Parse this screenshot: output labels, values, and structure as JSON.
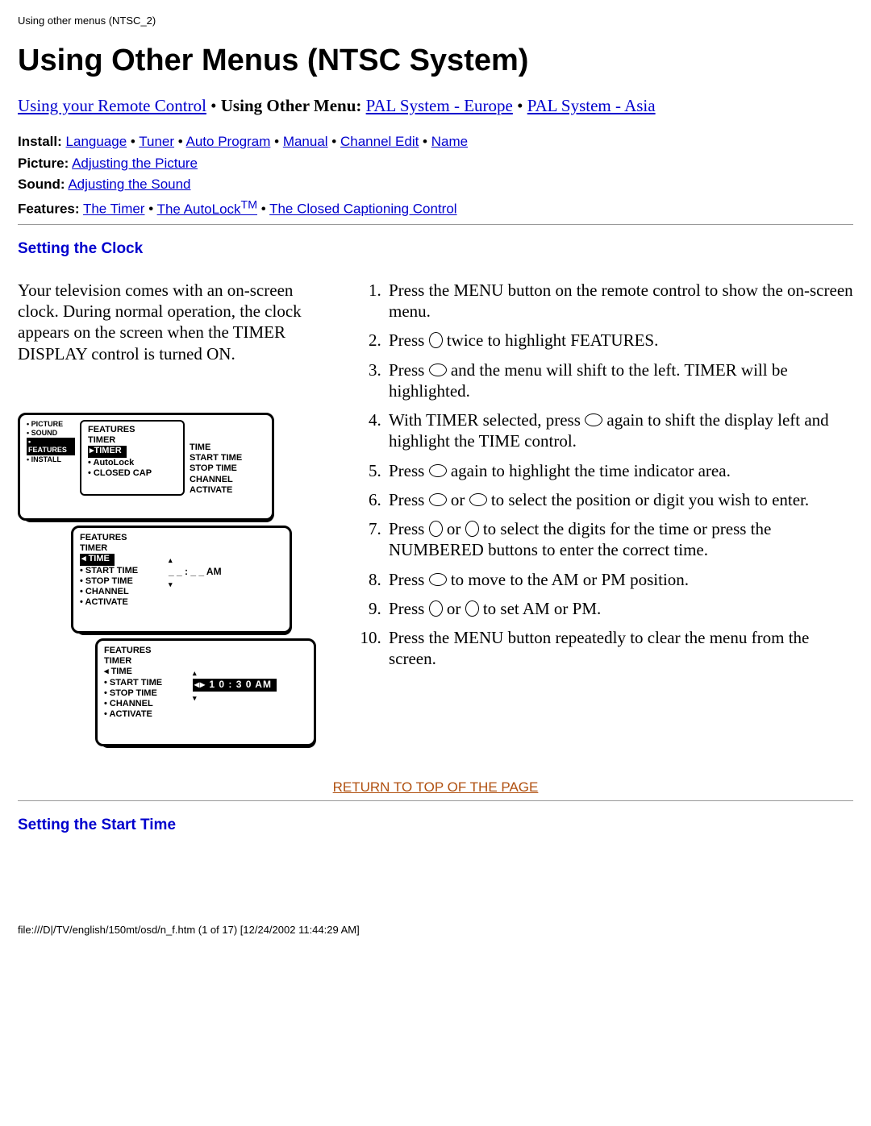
{
  "breadcrumb": "Using other menus (NTSC_2)",
  "page_title": "Using Other Menus (NTSC System)",
  "top_links": {
    "remote": "Using your Remote Control",
    "using_other_menu_label": "Using Other Menu:",
    "pal_europe": "PAL System - Europe",
    "pal_asia": "PAL System - Asia"
  },
  "sub_links": {
    "install_label": "Install:",
    "install_items": [
      "Language",
      "Tuner",
      "Auto Program",
      "Manual",
      "Channel Edit",
      "Name"
    ],
    "picture_label": "Picture:",
    "picture_link": "Adjusting the Picture",
    "sound_label": "Sound:",
    "sound_link": "Adjusting the Sound",
    "features_label": "Features:",
    "features_items": [
      "The Timer",
      "The AutoLock",
      "The Closed Captioning Control"
    ],
    "tm": "TM"
  },
  "section_clock": "Setting the Clock",
  "intro": "Your television comes with an on-screen clock. During normal operation, the clock appears on the screen when the TIMER DISPLAY control is turned ON.",
  "steps": [
    {
      "pre": "Press the MENU button on the remote control to show the on-screen menu."
    },
    {
      "pre": "Press ",
      "icon1": "down",
      "post": " twice to highlight FEATURES."
    },
    {
      "pre": "Press ",
      "icon1": "right",
      "post": " and the menu will shift to the left. TIMER will be highlighted."
    },
    {
      "pre": "With TIMER selected, press ",
      "icon1": "right",
      "post": " again to shift the display left and highlight the TIME control."
    },
    {
      "pre": "Press ",
      "icon1": "right",
      "post": " again to highlight the time indicator area."
    },
    {
      "pre": "Press ",
      "icon1": "left",
      "mid": " or ",
      "icon2": "right",
      "post": " to select the position or digit you wish to enter."
    },
    {
      "pre": "Press ",
      "icon1": "up",
      "mid": " or ",
      "icon2": "down",
      "post": " to select the digits for the time or press the NUMBERED buttons to enter the correct time."
    },
    {
      "pre": "Press ",
      "icon1": "right",
      "post": " to move to the AM or PM position."
    },
    {
      "pre": "Press ",
      "icon1": "up",
      "mid": " or ",
      "icon2": "down",
      "post": " to set AM or PM."
    },
    {
      "pre": "Press the MENU button repeatedly to clear the menu from the screen."
    }
  ],
  "osd": {
    "panel_a": {
      "side": [
        "• PICTURE",
        "• SOUND",
        "• FEATURES",
        "• INSTALL"
      ],
      "col1_title": "FEATURES",
      "col1": [
        "TIMER",
        "▸TIMER",
        "• AutoLock",
        "• CLOSED CAP"
      ],
      "col2": [
        "TIME",
        "START TIME",
        "STOP TIME",
        "CHANNEL",
        "ACTIVATE"
      ]
    },
    "panel_b": {
      "title": "FEATURES",
      "sub": "TIMER",
      "items": [
        "◂ TIME",
        "• START TIME",
        "• STOP TIME",
        "• CHANNEL",
        "• ACTIVATE"
      ],
      "value": "_ _ : _ _  AM"
    },
    "panel_c": {
      "title": "FEATURES",
      "sub": "TIMER",
      "items": [
        "◂ TIME",
        "• START TIME",
        "• STOP TIME",
        "• CHANNEL",
        "• ACTIVATE"
      ],
      "value": "1 0 : 3 0  AM"
    }
  },
  "return_top": "RETURN TO TOP OF THE PAGE",
  "section_start": "Setting the Start Time",
  "footer": "file:///D|/TV/english/150mt/osd/n_f.htm (1 of 17) [12/24/2002 11:44:29 AM]"
}
